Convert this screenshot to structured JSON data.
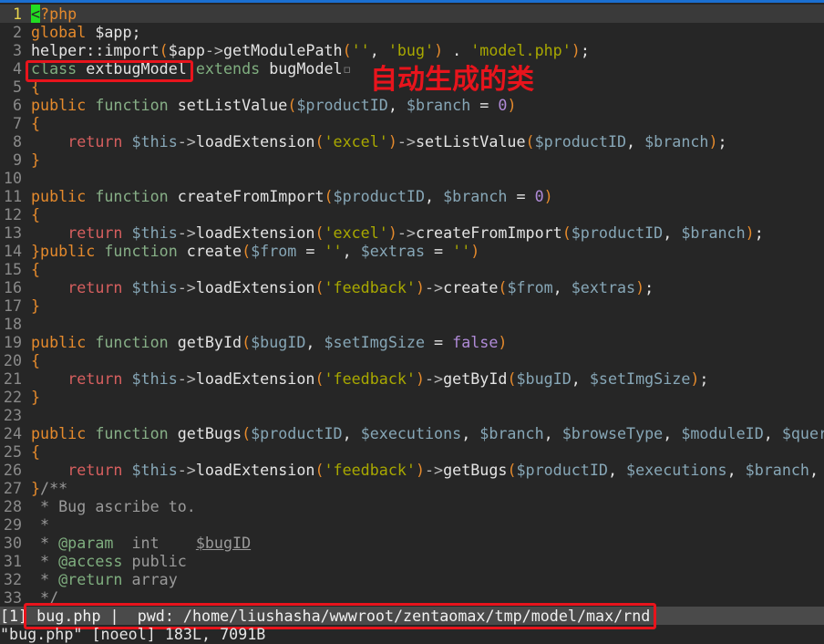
{
  "editor": {
    "current_line": 1,
    "lines": [
      [
        [
          "cursor",
          "<"
        ],
        [
          "k",
          "?php"
        ]
      ],
      [
        [
          "k",
          "global"
        ],
        [
          "i",
          " $app;"
        ]
      ],
      [
        [
          "i",
          "helper::import"
        ],
        [
          "k",
          "("
        ],
        [
          "i",
          "$app"
        ],
        [
          "o",
          "->"
        ],
        [
          "i",
          "getModulePath"
        ],
        [
          "k",
          "("
        ],
        [
          "s",
          "''"
        ],
        [
          "i",
          ", "
        ],
        [
          "s",
          "'bug'"
        ],
        [
          "k",
          ")"
        ],
        [
          "i",
          " . "
        ],
        [
          "s",
          "'model.php'"
        ],
        [
          "k",
          ")"
        ],
        [
          "i",
          ";"
        ]
      ],
      [
        [
          "g",
          "class"
        ],
        [
          "i",
          " extbugModel "
        ],
        [
          "g",
          "extends"
        ],
        [
          "i",
          " bugModel"
        ],
        [
          "e",
          "▫"
        ]
      ],
      [
        [
          "k",
          "{"
        ]
      ],
      [
        [
          "k",
          "public"
        ],
        [
          "i",
          " "
        ],
        [
          "f",
          "function"
        ],
        [
          "i",
          " setListValue"
        ],
        [
          "k",
          "("
        ],
        [
          "v",
          "$productID"
        ],
        [
          "i",
          ", "
        ],
        [
          "v",
          "$branch"
        ],
        [
          "i",
          " = "
        ],
        [
          "n",
          "0"
        ],
        [
          "k",
          ")"
        ]
      ],
      [
        [
          "k",
          "{"
        ]
      ],
      [
        [
          "i",
          "    "
        ],
        [
          "r",
          "return"
        ],
        [
          "i",
          " "
        ],
        [
          "v",
          "$this"
        ],
        [
          "o",
          "->"
        ],
        [
          "i",
          "loadExtension"
        ],
        [
          "k",
          "("
        ],
        [
          "s",
          "'excel'"
        ],
        [
          "k",
          ")"
        ],
        [
          "o",
          "->"
        ],
        [
          "i",
          "setListValue"
        ],
        [
          "k",
          "("
        ],
        [
          "v",
          "$productID"
        ],
        [
          "i",
          ", "
        ],
        [
          "v",
          "$branch"
        ],
        [
          "k",
          ")"
        ],
        [
          "i",
          ";"
        ]
      ],
      [
        [
          "k",
          "}"
        ]
      ],
      [],
      [
        [
          "k",
          "public"
        ],
        [
          "i",
          " "
        ],
        [
          "f",
          "function"
        ],
        [
          "i",
          " createFromImport"
        ],
        [
          "k",
          "("
        ],
        [
          "v",
          "$productID"
        ],
        [
          "i",
          ", "
        ],
        [
          "v",
          "$branch"
        ],
        [
          "i",
          " = "
        ],
        [
          "n",
          "0"
        ],
        [
          "k",
          ")"
        ]
      ],
      [
        [
          "k",
          "{"
        ]
      ],
      [
        [
          "i",
          "    "
        ],
        [
          "r",
          "return"
        ],
        [
          "i",
          " "
        ],
        [
          "v",
          "$this"
        ],
        [
          "o",
          "->"
        ],
        [
          "i",
          "loadExtension"
        ],
        [
          "k",
          "("
        ],
        [
          "s",
          "'excel'"
        ],
        [
          "k",
          ")"
        ],
        [
          "o",
          "->"
        ],
        [
          "i",
          "createFromImport"
        ],
        [
          "k",
          "("
        ],
        [
          "v",
          "$productID"
        ],
        [
          "i",
          ", "
        ],
        [
          "v",
          "$branch"
        ],
        [
          "k",
          ")"
        ],
        [
          "i",
          ";"
        ]
      ],
      [
        [
          "k",
          "}public"
        ],
        [
          "i",
          " "
        ],
        [
          "f",
          "function"
        ],
        [
          "i",
          " create"
        ],
        [
          "k",
          "("
        ],
        [
          "v",
          "$from"
        ],
        [
          "i",
          " = "
        ],
        [
          "s",
          "''"
        ],
        [
          "i",
          ", "
        ],
        [
          "v",
          "$extras"
        ],
        [
          "i",
          " = "
        ],
        [
          "s",
          "''"
        ],
        [
          "k",
          ")"
        ]
      ],
      [
        [
          "k",
          "{"
        ]
      ],
      [
        [
          "i",
          "    "
        ],
        [
          "r",
          "return"
        ],
        [
          "i",
          " "
        ],
        [
          "v",
          "$this"
        ],
        [
          "o",
          "->"
        ],
        [
          "i",
          "loadExtension"
        ],
        [
          "k",
          "("
        ],
        [
          "s",
          "'feedback'"
        ],
        [
          "k",
          ")"
        ],
        [
          "o",
          "->"
        ],
        [
          "i",
          "create"
        ],
        [
          "k",
          "("
        ],
        [
          "v",
          "$from"
        ],
        [
          "i",
          ", "
        ],
        [
          "v",
          "$extras"
        ],
        [
          "k",
          ")"
        ],
        [
          "i",
          ";"
        ]
      ],
      [
        [
          "k",
          "}"
        ]
      ],
      [],
      [
        [
          "k",
          "public"
        ],
        [
          "i",
          " "
        ],
        [
          "f",
          "function"
        ],
        [
          "i",
          " getById"
        ],
        [
          "k",
          "("
        ],
        [
          "v",
          "$bugID"
        ],
        [
          "i",
          ", "
        ],
        [
          "v",
          "$setImgSize"
        ],
        [
          "i",
          " = "
        ],
        [
          "n",
          "false"
        ],
        [
          "k",
          ")"
        ]
      ],
      [
        [
          "k",
          "{"
        ]
      ],
      [
        [
          "i",
          "    "
        ],
        [
          "r",
          "return"
        ],
        [
          "i",
          " "
        ],
        [
          "v",
          "$this"
        ],
        [
          "o",
          "->"
        ],
        [
          "i",
          "loadExtension"
        ],
        [
          "k",
          "("
        ],
        [
          "s",
          "'feedback'"
        ],
        [
          "k",
          ")"
        ],
        [
          "o",
          "->"
        ],
        [
          "i",
          "getById"
        ],
        [
          "k",
          "("
        ],
        [
          "v",
          "$bugID"
        ],
        [
          "i",
          ", "
        ],
        [
          "v",
          "$setImgSize"
        ],
        [
          "k",
          ")"
        ],
        [
          "i",
          ";"
        ]
      ],
      [
        [
          "k",
          "}"
        ]
      ],
      [],
      [
        [
          "k",
          "public"
        ],
        [
          "i",
          " "
        ],
        [
          "f",
          "function"
        ],
        [
          "i",
          " getBugs"
        ],
        [
          "k",
          "("
        ],
        [
          "v",
          "$productID"
        ],
        [
          "i",
          ", "
        ],
        [
          "v",
          "$executions"
        ],
        [
          "i",
          ", "
        ],
        [
          "v",
          "$branch"
        ],
        [
          "i",
          ", "
        ],
        [
          "v",
          "$browseType"
        ],
        [
          "i",
          ", "
        ],
        [
          "v",
          "$moduleID"
        ],
        [
          "i",
          ", "
        ],
        [
          "v",
          "$quer"
        ]
      ],
      [
        [
          "k",
          "{"
        ]
      ],
      [
        [
          "i",
          "    "
        ],
        [
          "r",
          "return"
        ],
        [
          "i",
          " "
        ],
        [
          "v",
          "$this"
        ],
        [
          "o",
          "->"
        ],
        [
          "i",
          "loadExtension"
        ],
        [
          "k",
          "("
        ],
        [
          "s",
          "'feedback'"
        ],
        [
          "k",
          ")"
        ],
        [
          "o",
          "->"
        ],
        [
          "i",
          "getBugs"
        ],
        [
          "k",
          "("
        ],
        [
          "v",
          "$productID"
        ],
        [
          "i",
          ", "
        ],
        [
          "v",
          "$executions"
        ],
        [
          "i",
          ", "
        ],
        [
          "v",
          "$branch"
        ],
        [
          "i",
          ","
        ]
      ],
      [
        [
          "k",
          "}"
        ],
        [
          "c",
          "/**"
        ]
      ],
      [
        [
          "c",
          " * Bug ascribe to."
        ]
      ],
      [
        [
          "c",
          " *"
        ]
      ],
      [
        [
          "c",
          " * "
        ],
        [
          "g",
          "@param"
        ],
        [
          "c",
          "  int    "
        ],
        [
          "u",
          "$bugID"
        ]
      ],
      [
        [
          "c",
          " * "
        ],
        [
          "g",
          "@access"
        ],
        [
          "c",
          " public"
        ]
      ],
      [
        [
          "c",
          " * "
        ],
        [
          "g",
          "@return"
        ],
        [
          "c",
          " array"
        ]
      ],
      [
        [
          "c",
          " */"
        ]
      ]
    ]
  },
  "annotation": "自动生成的类",
  "statusline": {
    "buffer": "[1]",
    "text": " bug.php |  pwd: /home/liushasha/wwwroot/zentaomax/tmp/model/max/rnd"
  },
  "cmdline": "\"bug.php\" [noeol] 183L, 7091B"
}
